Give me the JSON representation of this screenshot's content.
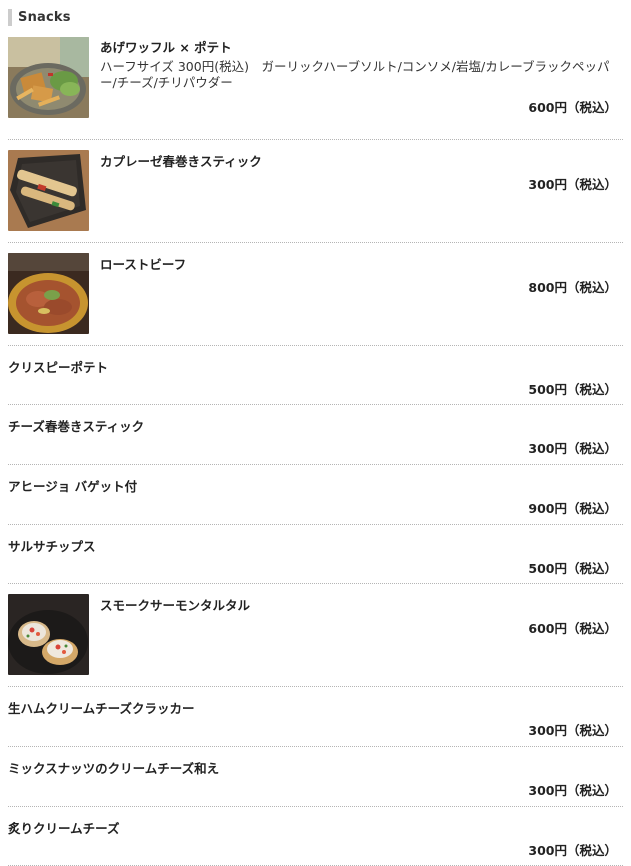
{
  "section": {
    "title": "Snacks"
  },
  "items": [
    {
      "name": "あげワッフル × ポテト",
      "description": "ハーフサイズ 300円(税込)　ガーリックハーブソルト/コンソメ/岩塩/カレーブラックペッパー/チーズ/チリパウダー",
      "price": "600円（税込）",
      "photo": "waffle-potato-photo"
    },
    {
      "name": "カプレーゼ春巻きスティック",
      "description": "",
      "price": "300円（税込）",
      "photo": "caprese-spring-roll-photo"
    },
    {
      "name": "ローストビーフ",
      "description": "",
      "price": "800円（税込）",
      "photo": "roast-beef-photo"
    },
    {
      "name": "クリスピーポテト",
      "description": "",
      "price": "500円（税込）"
    },
    {
      "name": "チーズ春巻きスティック",
      "description": "",
      "price": "300円（税込）"
    },
    {
      "name": "アヒージョ バゲット付",
      "description": "",
      "price": "900円（税込）"
    },
    {
      "name": "サルサチップス",
      "description": "",
      "price": "500円（税込）"
    },
    {
      "name": "スモークサーモンタルタル",
      "description": "",
      "price": "600円（税込）",
      "photo": "smoked-salmon-tartare-photo"
    },
    {
      "name": "生ハムクリームチーズクラッカー",
      "description": "",
      "price": "300円（税込）"
    },
    {
      "name": "ミックスナッツのクリームチーズ和え",
      "description": "",
      "price": "300円（税込）"
    },
    {
      "name": "炙りクリームチーズ",
      "description": "",
      "price": "300円（税込）"
    }
  ],
  "colors": {
    "section_bar": "#cccccc",
    "divider": "#b5b5b5",
    "text": "#222222"
  }
}
